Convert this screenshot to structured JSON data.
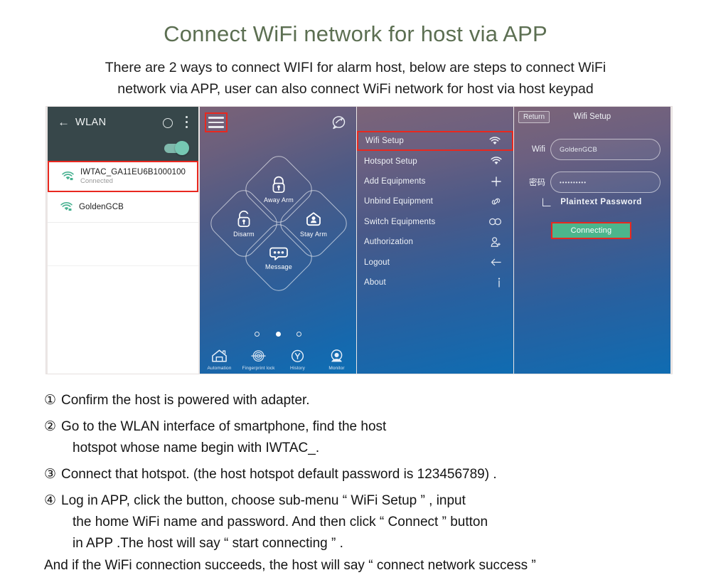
{
  "header": {
    "title": "Connect WiFi network for host via APP",
    "subtitle_line1": "There are 2 ways to connect WIFI for alarm host, below are steps to connect WiFi",
    "subtitle_line2": "network via APP, user can also connect WiFi network for host via host keypad"
  },
  "colors": {
    "title_green": "#5c6f52",
    "highlight_red": "#e8281f",
    "button_green": "#4cb68c",
    "wlan_bar": "#37474a"
  },
  "panel1": {
    "name": "android-wlan-screen",
    "back_icon": "back-arrow-icon",
    "title": "WLAN",
    "overflow_icon": "kebab-menu-icon",
    "circle_icon": "circle-icon",
    "wifi_toggle_state": "on",
    "networks": [
      {
        "ssid": "IWTAC_GA11EU6B1000100",
        "status": "Connected",
        "highlighted": true,
        "icon": "wifi-secure-icon"
      },
      {
        "ssid": "GoldenGCB",
        "status": "",
        "highlighted": false,
        "icon": "wifi-secure-icon"
      }
    ]
  },
  "panel2": {
    "name": "app-home-screen",
    "menu_icon": "hamburger-menu-icon",
    "menu_icon_highlighted": true,
    "top_right_icon": "message-bubble-icon",
    "tiles": [
      {
        "label": "Away Arm",
        "icon": "locked-padlock-icon",
        "position": "top"
      },
      {
        "label": "Disarm",
        "icon": "unlocked-padlock-icon",
        "position": "left"
      },
      {
        "label": "Stay Arm",
        "icon": "person-home-icon",
        "position": "right"
      },
      {
        "label": "Message",
        "icon": "chat-bubble-icon",
        "position": "bottom"
      }
    ],
    "page_dots": {
      "count": 3,
      "active_index": 1
    },
    "nav": [
      {
        "label": "Automation",
        "icon": "home-icon"
      },
      {
        "label": "Fingerprint lock",
        "icon": "fingerprint-icon"
      },
      {
        "label": "History",
        "icon": "clock-icon"
      },
      {
        "label": "Monitor",
        "icon": "camera-icon"
      }
    ]
  },
  "panel3": {
    "name": "app-side-menu",
    "items": [
      {
        "label": "Wifi Setup",
        "icon": "wifi-icon",
        "highlighted": true
      },
      {
        "label": "Hotspot Setup",
        "icon": "wifi-icon",
        "highlighted": false
      },
      {
        "label": "Add Equipments",
        "icon": "plus-icon",
        "highlighted": false
      },
      {
        "label": "Unbind Equipment",
        "icon": "link-icon",
        "highlighted": false
      },
      {
        "label": "Switch Equipments",
        "icon": "infinity-icon",
        "highlighted": false
      },
      {
        "label": "Authorization",
        "icon": "add-user-icon",
        "highlighted": false
      },
      {
        "label": "Logout",
        "icon": "logout-arrow-icon",
        "highlighted": false
      },
      {
        "label": "About",
        "icon": "info-icon",
        "highlighted": false
      }
    ]
  },
  "panel4": {
    "name": "wifi-setup-screen",
    "return_label": "Return",
    "title": "Wifi Setup",
    "wifi_label": "Wifi",
    "wifi_value": "GoldenGCB",
    "password_label": "密码",
    "password_value": "••••••••••",
    "plaintext_label": "Plaintext Password",
    "plaintext_checked": false,
    "connect_label": "Connecting",
    "connect_highlighted": true
  },
  "steps": [
    {
      "num": "①",
      "lines": [
        "Confirm the host is powered with adapter."
      ]
    },
    {
      "num": "②",
      "lines": [
        "Go to the WLAN interface of smartphone, find the host",
        "hotspot whose name begin with IWTAC_."
      ]
    },
    {
      "num": "③",
      "lines": [
        "Connect that hotspot. (the host hotspot default password is 123456789) ."
      ]
    },
    {
      "num": "④",
      "lines": [
        "Log in APP, click the      button, choose sub-menu “ WiFi Setup ” , input",
        "the home WiFi name and password. And then click “ Connect ”  button",
        "in APP .The host will say “  start connecting ” ."
      ]
    }
  ],
  "footer_note": "And if the WiFi connection succeeds, the host will say “ connect network success ”"
}
